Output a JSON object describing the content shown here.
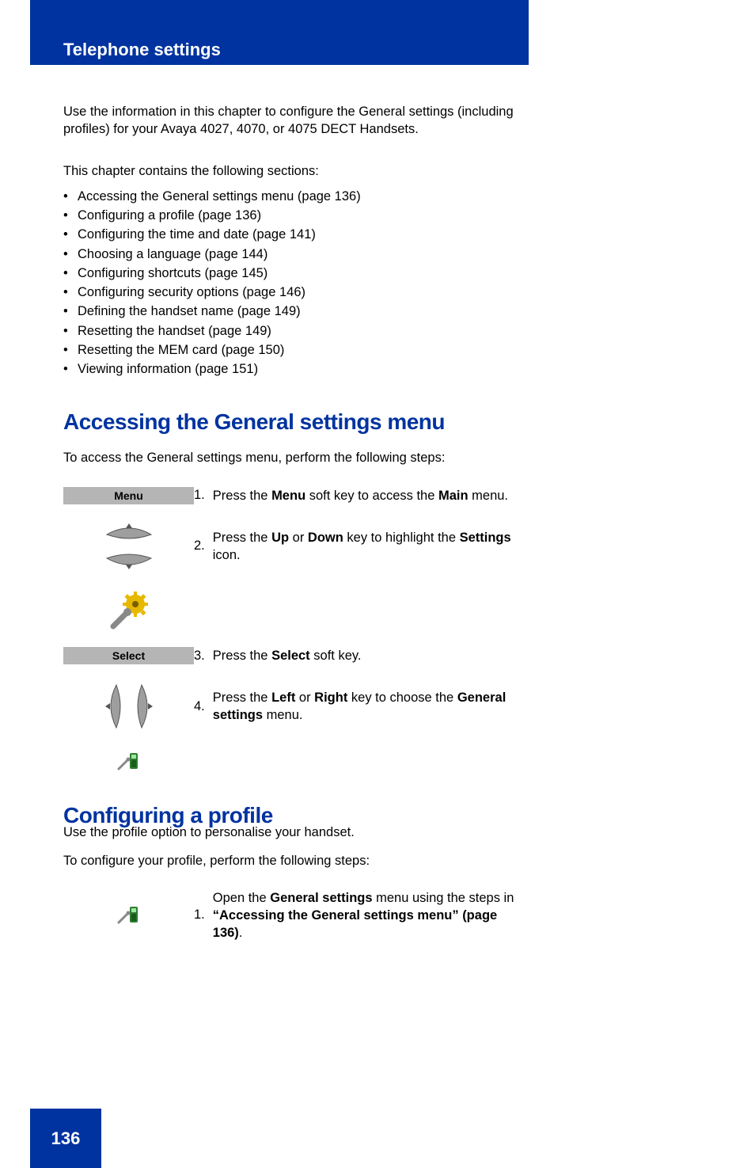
{
  "header": {
    "section_title": "Telephone settings"
  },
  "intro_paragraph": "Use the information in this chapter to configure the General settings (including profiles) for your Avaya 4027, 4070, or 4075 DECT Handsets.",
  "summary_lead": "This chapter contains the following sections:",
  "bullets": [
    "Accessing the General settings menu (page 136)",
    "Configuring a profile (page 136)",
    "Configuring the time and date (page 141)",
    "Choosing a language (page 144)",
    "Configuring shortcuts (page 145)",
    "Configuring security options (page 146)",
    "Defining the handset name (page 149)",
    "Resetting the handset (page 149)",
    "Resetting the MEM card (page 150)",
    "Viewing information (page 151)"
  ],
  "h2_accessing": "Accessing the General settings menu",
  "accessing_lead": "To access the General settings menu, perform the following steps:",
  "steps": [
    {
      "button": "Menu",
      "type": "softkey",
      "desc_parts": [
        "Press the ",
        "Menu",
        " soft key to access the ",
        "Main",
        " menu."
      ]
    },
    {
      "type": "nav_updown",
      "desc_parts": [
        "Press the ",
        "Up",
        " or ",
        "Down",
        " key to highlight the ",
        "Settings",
        " icon."
      ]
    },
    {
      "type": "settings_icon"
    },
    {
      "button": "Select",
      "type": "softkey",
      "desc_parts": [
        "Press the ",
        "Select",
        " soft key."
      ]
    },
    {
      "type": "nav_leftright",
      "desc_parts": [
        "Press the ",
        "Left",
        " or ",
        "Right",
        " key to choose the ",
        "General settings",
        " menu."
      ]
    },
    {
      "type": "general_icon"
    }
  ],
  "h2_profile": "Configuring a profile",
  "profile_body_1": "Use the profile option to personalise your handset.",
  "profile_lead": "To configure your profile, perform the following steps:",
  "profile_step_icon": "general_icon",
  "profile_step_desc_parts": [
    "Open the ",
    "General settings",
    " menu using the steps in ",
    "“Accessing the General settings menu” (page 136)",
    "."
  ],
  "page_number": "136"
}
